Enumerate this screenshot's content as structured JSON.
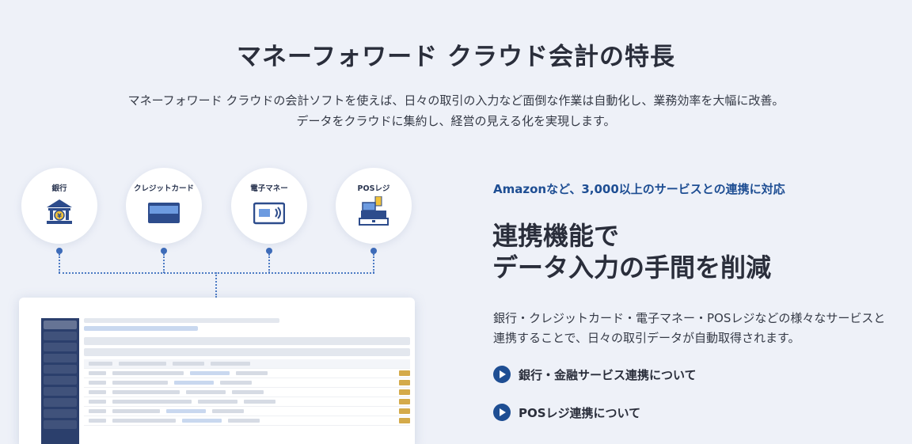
{
  "section": {
    "title": "マネーフォワード クラウド会計の特長",
    "lead_line1": "マネーフォワード クラウドの会計ソフトを使えば、日々の取引の入力など面倒な作業は自動化し、業務効率を大幅に改善。",
    "lead_line2": "データをクラウドに集約し、経営の見える化を実現します。"
  },
  "services": [
    {
      "label": "銀行",
      "icon": "bank-icon"
    },
    {
      "label": "クレジットカード",
      "icon": "credit-card-icon"
    },
    {
      "label": "電子マネー",
      "icon": "e-money-icon"
    },
    {
      "label": "POSレジ",
      "icon": "pos-register-icon"
    }
  ],
  "feature": {
    "subheading": "Amazonなど、3,000以上のサービスとの連携に対応",
    "heading_line1": "連携機能で",
    "heading_line2": "データ入力の手間を削減",
    "description": "銀行・クレジットカード・電子マネー・POSレジなどの様々なサービスと連携することで、日々の取引データが自動取得されます。",
    "links": [
      {
        "label": "銀行・金融サービス連携について"
      },
      {
        "label": "POSレジ連携について"
      }
    ]
  },
  "colors": {
    "accent": "#1e4e93",
    "background": "#eef1f8"
  }
}
